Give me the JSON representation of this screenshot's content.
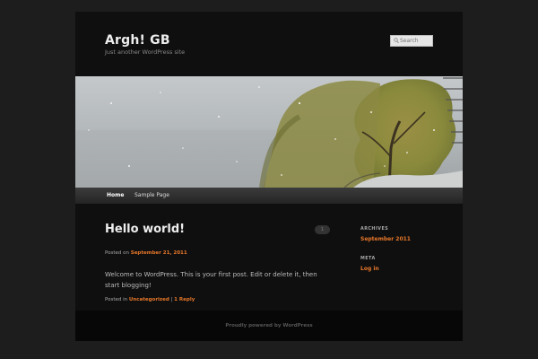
{
  "site": {
    "title": "Argh! GB",
    "description": "Just another WordPress site"
  },
  "search": {
    "placeholder": "Search"
  },
  "nav": {
    "items": [
      {
        "label": "Home"
      },
      {
        "label": "Sample Page"
      }
    ]
  },
  "post": {
    "title": "Hello world!",
    "comment_count": "1",
    "posted_on_prefix": "Posted on ",
    "date": "September 21, 2011",
    "content": "Welcome to WordPress. This is your first post. Edit or delete it, then start blogging!",
    "posted_in_prefix": "Posted in ",
    "category": "Uncategorized",
    "separator": " | ",
    "reply_link": "1 Reply"
  },
  "sidebar": {
    "archives": {
      "title": "ARCHIVES",
      "items": [
        {
          "label": "September 2011"
        }
      ]
    },
    "meta": {
      "title": "META",
      "items": [
        {
          "label": "Log in"
        }
      ]
    }
  },
  "footer": {
    "credit": "Proudly powered by WordPress"
  },
  "colors": {
    "accent": "#e7772a",
    "background": "#1d1d1d",
    "page": "#0f0f0f"
  }
}
